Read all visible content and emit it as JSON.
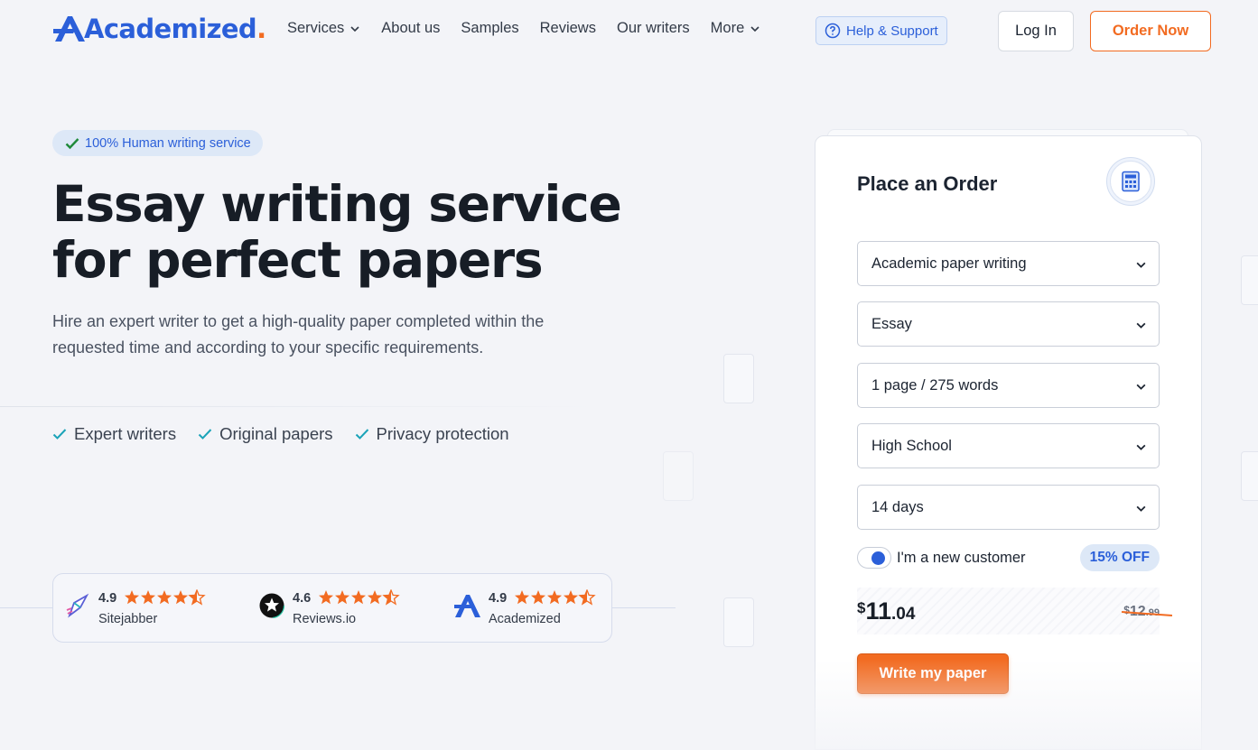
{
  "brand": {
    "name": "Academized",
    "dot": ".",
    "colors": {
      "primary": "#2b5fd9",
      "accent": "#f26b21"
    }
  },
  "nav": {
    "items": [
      {
        "label": "Services",
        "has_dropdown": true
      },
      {
        "label": "About us",
        "has_dropdown": false
      },
      {
        "label": "Samples",
        "has_dropdown": false
      },
      {
        "label": "Reviews",
        "has_dropdown": false
      },
      {
        "label": "Our writers",
        "has_dropdown": false
      },
      {
        "label": "More",
        "has_dropdown": true
      }
    ],
    "help_label": "Help & Support",
    "login_label": "Log In",
    "order_label": "Order Now"
  },
  "hero": {
    "badge": "100% Human writing service",
    "title_line1": "Essay writing service",
    "title_line2": "for perfect papers",
    "subtitle": "Hire an expert writer to get a high-quality paper completed within the requested time and according to your specific requirements.",
    "features": [
      "Expert writers",
      "Original papers",
      "Privacy protection"
    ]
  },
  "ratings": [
    {
      "score": "4.9",
      "stars": 4.5,
      "source": "Sitejabber",
      "icon": "sitejabber-icon"
    },
    {
      "score": "4.6",
      "stars": 4.5,
      "source": "Reviews.io",
      "icon": "reviews-io-icon"
    },
    {
      "score": "4.9",
      "stars": 4.5,
      "source": "Academized",
      "icon": "academized-icon"
    }
  ],
  "order_form": {
    "title": "Place an Order",
    "selects": [
      {
        "value": "Academic paper writing"
      },
      {
        "value": "Essay"
      },
      {
        "value": "1 page / 275 words"
      },
      {
        "value": "High School"
      },
      {
        "value": "14 days"
      }
    ],
    "new_customer_label": "I'm a new customer",
    "new_customer_on": true,
    "discount": "15% OFF",
    "price": {
      "currency": "$",
      "int": "11",
      "cents": ".04"
    },
    "old_price": {
      "currency": "$",
      "int": "12",
      "cents": ".99"
    },
    "submit_label": "Write my paper"
  }
}
